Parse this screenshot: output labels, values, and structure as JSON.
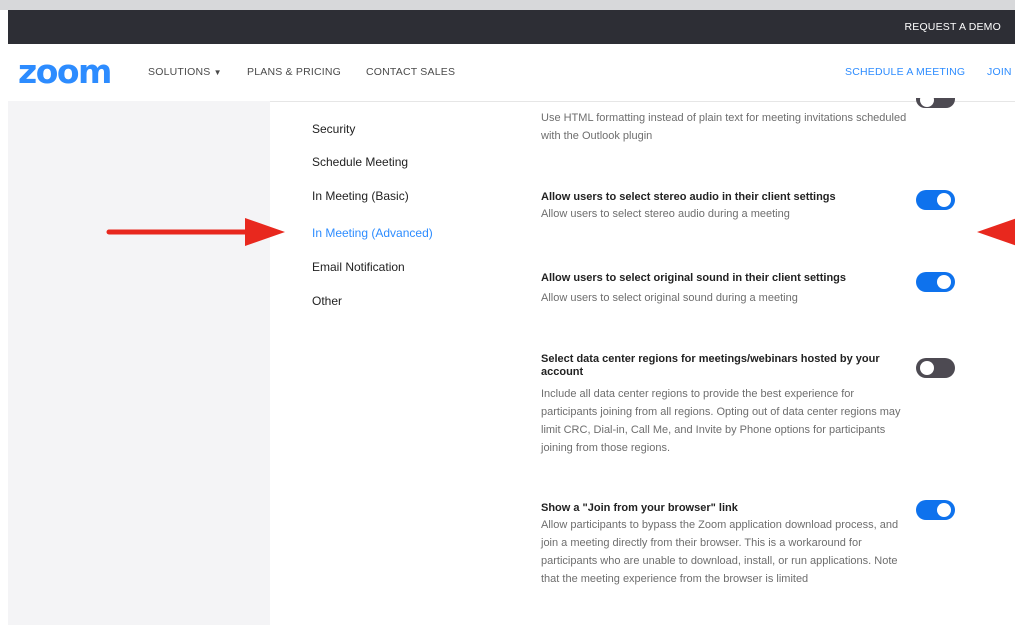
{
  "topbar": {
    "request_demo": "REQUEST A DEMO"
  },
  "nav": {
    "logo": "zoom",
    "solutions": "SOLUTIONS",
    "plans": "PLANS & PRICING",
    "contact": "CONTACT SALES",
    "schedule": "SCHEDULE A MEETING",
    "join": "JOIN"
  },
  "menu": [
    {
      "label": "Security",
      "active": false
    },
    {
      "label": "Schedule Meeting",
      "active": false
    },
    {
      "label": "In Meeting (Basic)",
      "active": false
    },
    {
      "label": "In Meeting (Advanced)",
      "active": true
    },
    {
      "label": "Email Notification",
      "active": false
    },
    {
      "label": "Other",
      "active": false
    }
  ],
  "settings": [
    {
      "desc": "Use HTML formatting instead of plain text for meeting invitations scheduled with the Outlook plugin",
      "enabled": false
    },
    {
      "title": "Allow users to select stereo audio in their client settings",
      "desc": "Allow users to select stereo audio during a meeting",
      "enabled": true
    },
    {
      "title": "Allow users to select original sound in their client settings",
      "desc": "Allow users to select original sound during a meeting",
      "enabled": true
    },
    {
      "title": "Select data center regions for meetings/webinars hosted by your account",
      "desc": "Include all data center regions to provide the best experience for participants joining from all regions. Opting out of data center regions may limit CRC, Dial-in, Call Me, and Invite by Phone options for participants joining from those regions.",
      "enabled": false
    },
    {
      "title": "Show a \"Join from your browser\" link",
      "desc": "Allow participants to bypass the Zoom application download process, and join a meeting directly from their browser. This is a workaround for participants who are unable to download, install, or run applications. Note that the meeting experience from the browser is limited",
      "enabled": true
    }
  ],
  "colors": {
    "accent": "#2d8cff",
    "toggle_on": "#0e72ed",
    "toggle_off": "#4d4a52",
    "arrow": "#e8281e"
  }
}
